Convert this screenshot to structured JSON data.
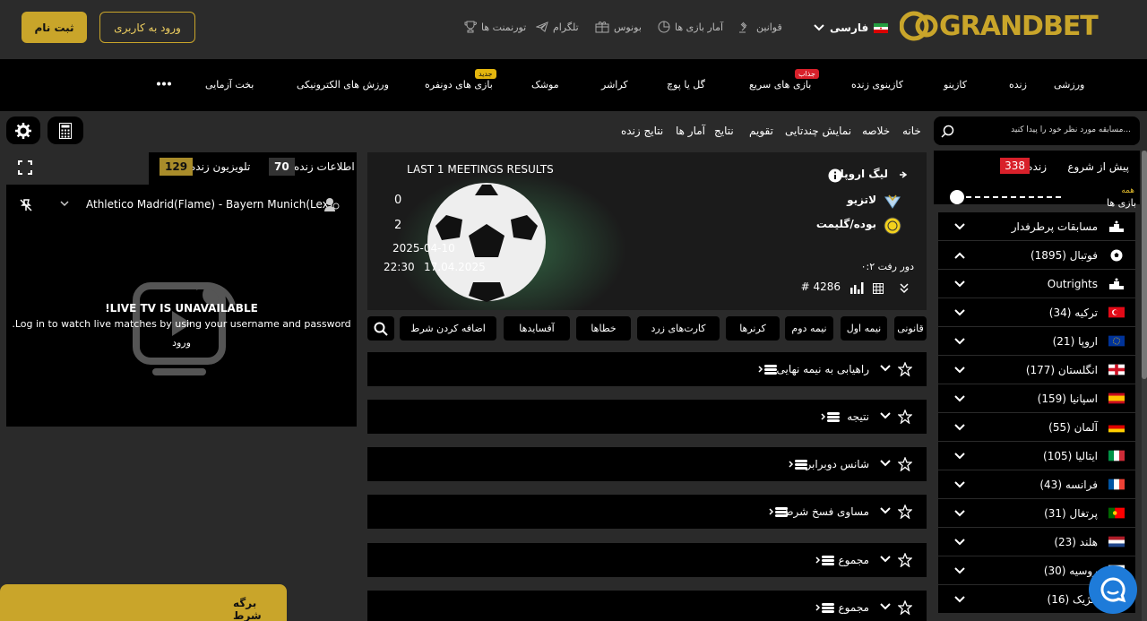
{
  "header": {
    "register": "ثبت نام",
    "login": "ورود به کاربری",
    "nav": [
      {
        "label": "تورنمنت ها",
        "icon": "trophy-icon"
      },
      {
        "label": "تلگرام",
        "icon": "telegram-icon"
      },
      {
        "label": "بونوس",
        "icon": "gift-icon"
      },
      {
        "label": "آمار بازی ها",
        "icon": "stats-icon"
      },
      {
        "label": "قوانین",
        "icon": "gavel-icon"
      }
    ],
    "language": "فارسی",
    "logo": "GRANDBET"
  },
  "categories": [
    {
      "label": "ورزشی"
    },
    {
      "label": "زنده"
    },
    {
      "label": "کازینو"
    },
    {
      "label": "کازینوی زنده"
    },
    {
      "label": "بازی های سریع",
      "badge": "جذاب"
    },
    {
      "label": "گل یا پوچ"
    },
    {
      "label": "کراشر"
    },
    {
      "label": "موشک"
    },
    {
      "label": "بازی های دونفره",
      "badge": "جدید"
    },
    {
      "label": "ورزش های الکترونیکی"
    },
    {
      "label": "بخت آزمایی"
    }
  ],
  "sidebar": {
    "search_placeholder": "مسابقه مورد نظر خود را پیدا کنید...",
    "prematch": "پیش از شروع",
    "live": "زنده",
    "live_count": "338",
    "all_games_line1": "همه",
    "all_games_line2": "بازی ها",
    "items": [
      {
        "label": "مسابقات پرطرفدار",
        "icon": "podium-icon",
        "open": false
      },
      {
        "label": "فوتبال (1895)",
        "icon": "football-icon",
        "open": true
      },
      {
        "label": "Outrights",
        "icon": "podium-icon",
        "open": false
      },
      {
        "label": "ترکیه (34)",
        "icon": "flag-turkey-icon",
        "open": false
      },
      {
        "label": "اروپا (21)",
        "icon": "flag-europe-icon",
        "open": false
      },
      {
        "label": "انگلستان (177)",
        "icon": "flag-england-icon",
        "open": false
      },
      {
        "label": "اسپانیا (159)",
        "icon": "flag-spain-icon",
        "open": false
      },
      {
        "label": "آلمان (55)",
        "icon": "flag-germany-icon",
        "open": false
      },
      {
        "label": "ایتالیا (105)",
        "icon": "flag-italy-icon",
        "open": false
      },
      {
        "label": "فرانسه (43)",
        "icon": "flag-france-icon",
        "open": false
      },
      {
        "label": "پرتغال (31)",
        "icon": "flag-portugal-icon",
        "open": false
      },
      {
        "label": "هلند (23)",
        "icon": "flag-netherlands-icon",
        "open": false
      },
      {
        "label": "روسیه (30)",
        "icon": "flag-russia-icon",
        "open": false
      },
      {
        "label": "بلژیک (16)",
        "icon": "flag-belgium-icon",
        "open": false
      }
    ]
  },
  "breadcrumbs": [
    "خانه",
    "خلاصه",
    "نمایش چندتایی",
    "تقویم",
    "نتایج",
    "آمار ها",
    "نتایج زنده"
  ],
  "match": {
    "league": "لیگ اروپا",
    "team1": "لاتزیو",
    "team2": "بوده/گلیمت",
    "score1": "0",
    "score2": "2",
    "leg_info": "دور رفت ۰:۲",
    "match_id": "# 4286",
    "last_meetings": "LAST 1 MEETINGS RESULTS",
    "meeting_date": "2025-04-10",
    "date": "17.04.2025",
    "time": "22:30"
  },
  "market_tabs": [
    "قانونی",
    "نیمه اول",
    "نیمه دوم",
    "کرنرها",
    "کارت‌های زرد",
    "خطاها",
    "آفسایدها",
    "اضافه کردن شرط"
  ],
  "markets": [
    "راهیابی به نیمه نهایی",
    "نتیجه",
    "شانس دوبرابر",
    "مساوی فسخ شرط",
    "مجموع",
    "مجموع"
  ],
  "tv": {
    "live_info": "اطلاعات زنده",
    "live_info_count": "70",
    "live_tv": "تلویزیون زنده",
    "live_tv_count": "129",
    "match_title": "Athletico Madrid(Flame) - Bayern Munich(Lex)",
    "unavailable": "!LIVE TV IS UNAVAILABLE",
    "login_msg": ".Log in to watch live matches by using your username and password",
    "login_btn": "ورود"
  },
  "betslip": "برگه شرط",
  "colors": {
    "gold": "#c9a52a",
    "red": "#d8202a",
    "chat": "#1e7bd9"
  }
}
